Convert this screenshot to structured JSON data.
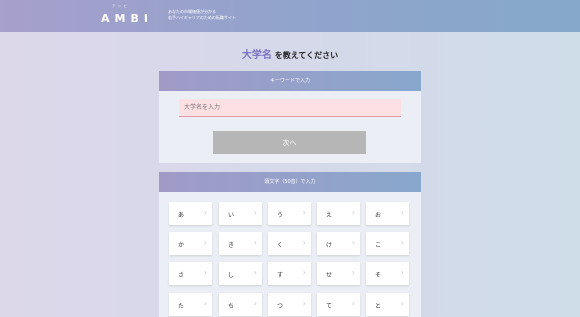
{
  "header": {
    "logo": "AMBI",
    "logo_ruby": "アンビ",
    "tagline_line1": "あなたの市場価値が分かる",
    "tagline_line2": "若手ハイキャリアのための転職サイト"
  },
  "page_title": {
    "highlight": "大学名",
    "rest": "を教えてください"
  },
  "keyword_panel": {
    "heading": "キーワードで入力",
    "placeholder": "大学名を入力",
    "next_label": "次へ"
  },
  "kana_panel": {
    "heading": "頭文字（50音）で入力",
    "rows": [
      [
        "あ",
        "い",
        "う",
        "え",
        "お"
      ],
      [
        "か",
        "き",
        "く",
        "け",
        "こ"
      ],
      [
        "さ",
        "し",
        "す",
        "せ",
        "そ"
      ],
      [
        "た",
        "ち",
        "つ",
        "て",
        "と"
      ]
    ]
  },
  "icons": {
    "chevron": "chevron-right-icon"
  }
}
